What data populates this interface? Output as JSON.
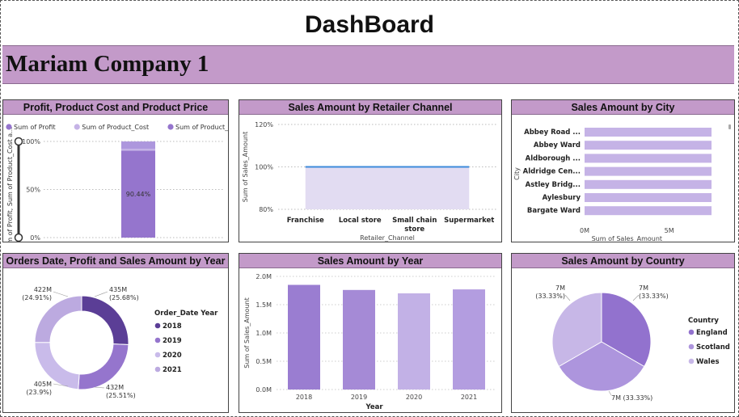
{
  "page": {
    "title": "DashBoard",
    "company": "Mariam Company 1"
  },
  "colors": {
    "header_bar": "#c39ac9",
    "purple_dark": "#5b3e96",
    "purple_mid": "#9575cd",
    "purple_light": "#c5b3e6",
    "line_blue": "#3d8bdb"
  },
  "chart_data": [
    {
      "type": "bar",
      "title": "Profit, Product Cost and Product Price",
      "legend": [
        "Sum of Profit",
        "Sum of Product_Cost",
        "Sum of Product_Price"
      ],
      "ylabel": "Sum of Profit, Sum of Product_Cost a...",
      "yticks": [
        "100%",
        "50%",
        "0%"
      ],
      "series": [
        {
          "name": "Sum of Profit",
          "value": 0.9044,
          "label": "90.44%"
        },
        {
          "name": "Sum of Product_Cost",
          "value": 0.02
        },
        {
          "name": "Sum of Product_Price",
          "value": 0.075
        }
      ],
      "stacked": "100%"
    },
    {
      "type": "area",
      "title": "Sales Amount by Retailer Channel",
      "categories": [
        "Franchise",
        "Local store",
        "Small chain store",
        "Supermarket"
      ],
      "values": [
        100,
        100,
        100,
        100
      ],
      "ylim": [
        80,
        120
      ],
      "yticks": [
        "120%",
        "100%",
        "80%"
      ],
      "ylabel": "Sum of Sales_Amount",
      "xlabel": "Retailer_Channel"
    },
    {
      "type": "bar",
      "orientation": "horizontal",
      "title": "Sales Amount by City",
      "categories": [
        "Abbey Road ...",
        "Abbey Ward",
        "Aldborough ...",
        "Aldridge Cen...",
        "Astley Bridg...",
        "Aylesbury",
        "Bargate Ward"
      ],
      "values": [
        7.5,
        7.5,
        7.5,
        7.5,
        7.5,
        7.5,
        7.5
      ],
      "xticks": [
        "0M",
        "5M"
      ],
      "xlabel": "Sum of Sales_Amount",
      "ylabel": "City"
    },
    {
      "type": "pie",
      "variant": "donut",
      "title": "Orders Date, Profit and Sales Amount by Year",
      "legend_title": "Order_Date Year",
      "categories": [
        "2018",
        "2019",
        "2020",
        "2021"
      ],
      "values": [
        435,
        432,
        405,
        422
      ],
      "value_labels": [
        "435M",
        "432M",
        "405M",
        "422M"
      ],
      "percent_labels": [
        "(25.68%)",
        "(25.51%)",
        "(23.9%)",
        "(24.91%)"
      ]
    },
    {
      "type": "bar",
      "title": "Sales Amount by Year",
      "categories": [
        "2018",
        "2019",
        "2020",
        "2021"
      ],
      "values": [
        1.85,
        1.76,
        1.7,
        1.77
      ],
      "ylim": [
        0,
        2.0
      ],
      "yticks": [
        "2.0M",
        "1.5M",
        "1.0M",
        "0.5M",
        "0.0M"
      ],
      "ylabel": "Sum of Sales_Amount",
      "xlabel": "Year"
    },
    {
      "type": "pie",
      "title": "Sales Amount by Country",
      "legend_title": "Country",
      "categories": [
        "England",
        "Scotland",
        "Wales"
      ],
      "values": [
        7,
        7,
        7
      ],
      "value_labels": [
        "7M",
        "7M",
        "7M"
      ],
      "percent_labels": [
        "(33.33%)",
        "(33.33%)",
        "(33.33%)"
      ]
    }
  ]
}
